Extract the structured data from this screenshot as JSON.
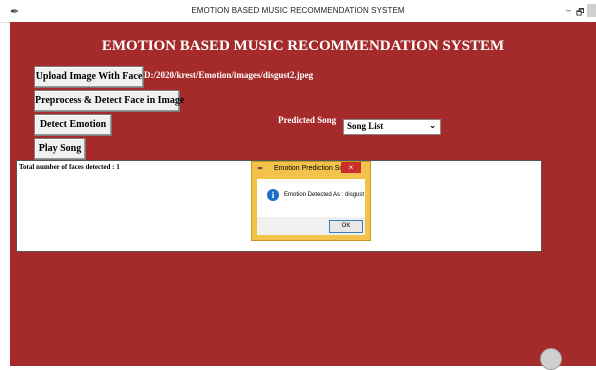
{
  "window": {
    "title": "EMOTION BASED MUSIC RECOMMENDATION SYSTEM",
    "app_icon": "feather-icon",
    "minimize_glyph": "–",
    "maximize_glyph": "🗗"
  },
  "app": {
    "title": "EMOTION BASED MUSIC RECOMMENDATION SYSTEM",
    "image_path": "D:/2020/krest/Emotion/images/disgust2.jpeg",
    "predicted_song_label": "Predicted Song",
    "song_list_value": "Song List",
    "faces_detected_text": "Total number of faces detected : 1"
  },
  "buttons": {
    "upload": "Upload Image With Face",
    "preprocess": "Preprocess & Detect Face in Image",
    "detect_emotion": "Detect Emotion",
    "play_song": "Play Song"
  },
  "dialog": {
    "title": "Emotion Prediction Screen",
    "close_glyph": "×",
    "info_glyph": "i",
    "message": "Emotion Detected As : disgust",
    "ok_label": "OK"
  },
  "colors": {
    "background": "#a52a2a",
    "dialog_frame": "#f3c24d",
    "info_icon": "#1b6fc4"
  }
}
